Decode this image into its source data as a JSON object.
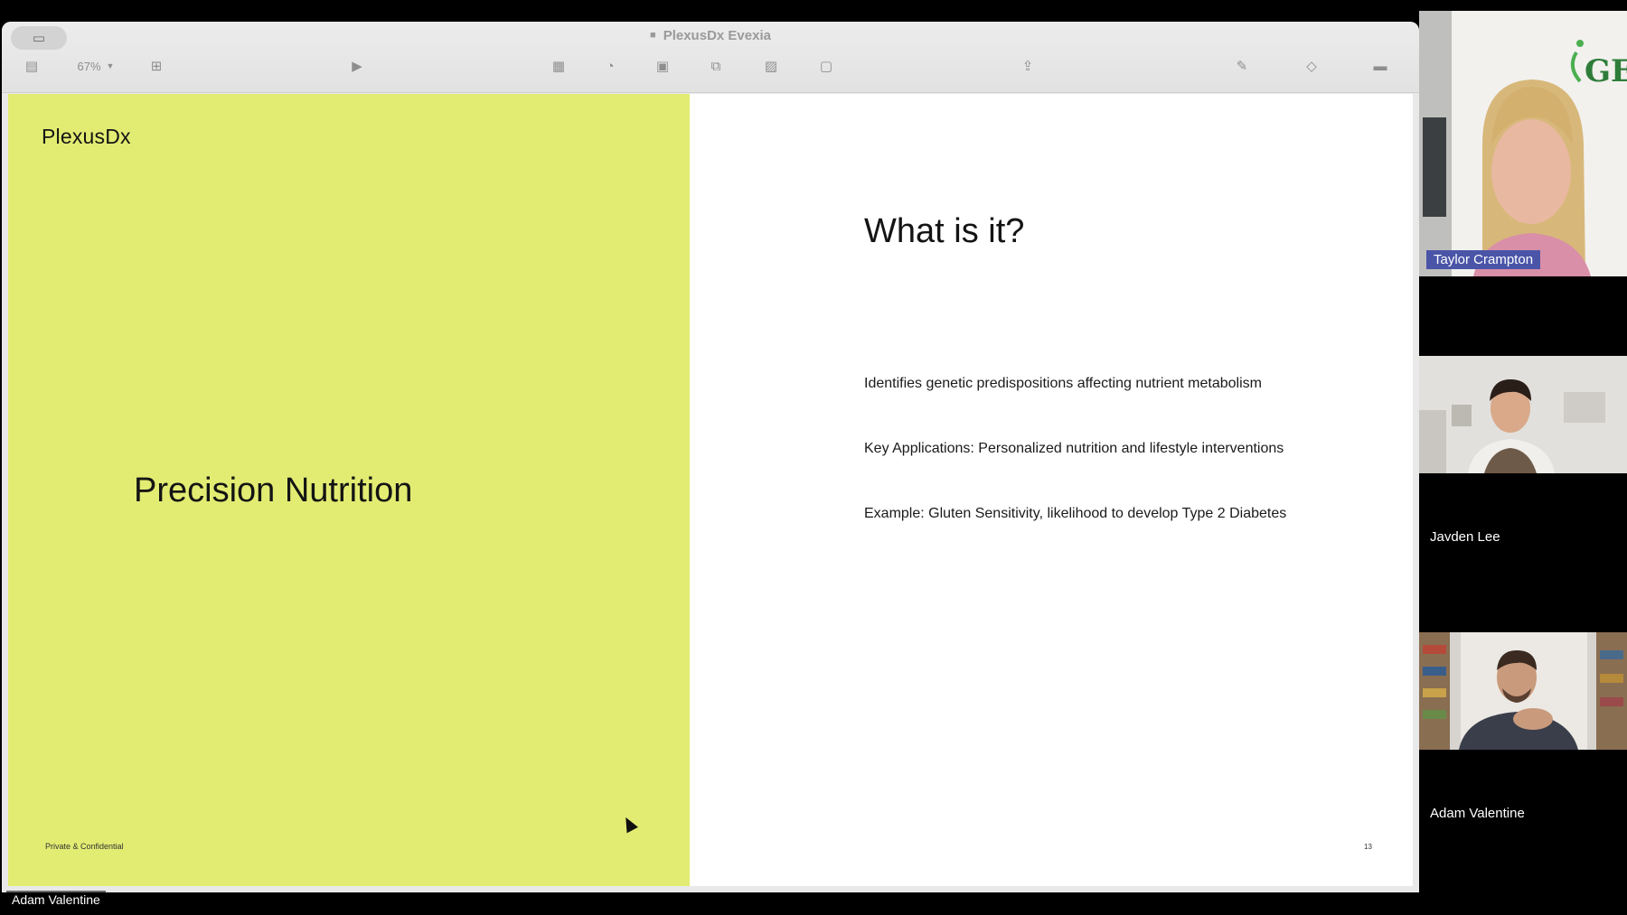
{
  "window": {
    "title": "PlexusDx Evexia",
    "zoom_label": "67%",
    "toolbar_icons": [
      "sidebar-icon",
      "add-slide-icon",
      "play-icon",
      "table-icon",
      "chart-icon",
      "text-icon",
      "shape-icon",
      "media-icon",
      "comment-icon",
      "share-icon",
      "format-icon",
      "animate-icon",
      "document-icon"
    ]
  },
  "slide": {
    "logo": "PlexusDx",
    "left_title": "Precision Nutrition",
    "footer": "Private & Confidential",
    "right_title": "What is it?",
    "bullets": [
      "Identifies genetic predispositions affecting nutrient metabolism",
      "Key Applications: Personalized nutrition and lifestyle interventions",
      "Example: Gluten Sensitivity, likelihood to develop Type 2 Diabetes"
    ],
    "page_number": "13",
    "colors": {
      "left_panel": "#e2ec72",
      "right_panel": "#ffffff"
    }
  },
  "presenter_label": "Adam Valentine",
  "participants": [
    {
      "name": "Taylor Crampton",
      "active_speaker": true,
      "background_logo_text": "GEN"
    },
    {
      "name": "Jayden Lee",
      "active_speaker": false
    },
    {
      "name": "Adam Valentine",
      "active_speaker": false
    }
  ]
}
